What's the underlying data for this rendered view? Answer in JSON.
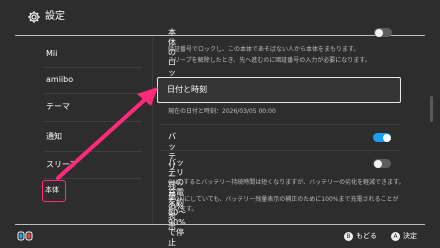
{
  "header": {
    "title": "設定",
    "icon": "gear-icon"
  },
  "sidebar": {
    "items": [
      {
        "label": "Mii"
      },
      {
        "label": "amiibo"
      },
      {
        "label": "テーマ"
      },
      {
        "label": "通知"
      },
      {
        "label": "スリープ"
      },
      {
        "label": "本体"
      }
    ],
    "selected_index": 5,
    "highlight_color": "#ff2a79"
  },
  "main": {
    "console_lock": {
      "label": "本体のロック",
      "toggle": "off",
      "description_line1": "暗証番号でロックし、この本体であそばない人から本体をまもります。",
      "description_line2": "スリープを解除したとき、先へ進むのに暗証番号の入力が必要になります。"
    },
    "date_time": {
      "label": "日付と時刻",
      "current": "現在の日付と時刻：2026/03/05 00:00"
    },
    "battery_percent": {
      "label": "バッテリー残量の%表示",
      "toggle": "on"
    },
    "battery_charge": {
      "label": "バッテリーの充電を約80〜90%で停止",
      "toggle": "off",
      "description_line1": "ONにするとバッテリー持続時間は短くなりますが、バッテリーの劣化を軽減できます。",
      "description_line2": "※ ONにしていても、バッテリー残量表示の補正のために100%まで充電されることが",
      "description_line3": "あります。"
    }
  },
  "footer": {
    "back": {
      "button": "B",
      "label": "もどる"
    },
    "ok": {
      "button": "A",
      "label": "決定"
    },
    "icon": "controller-icon"
  },
  "colors": {
    "accent": "#19a0f2",
    "annotation": "#ff2a79",
    "background": "#2d2d2d"
  }
}
